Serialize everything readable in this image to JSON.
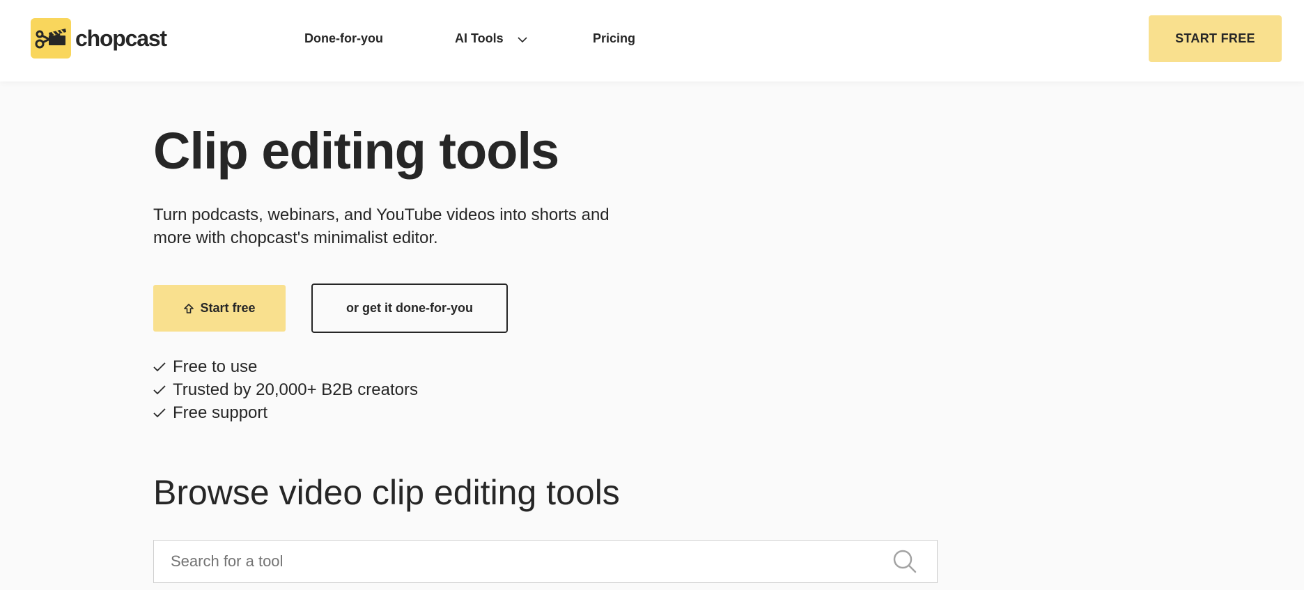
{
  "header": {
    "brand": "chopcast",
    "nav": [
      {
        "label": "Done-for-you"
      },
      {
        "label": "AI Tools",
        "has_dropdown": true
      },
      {
        "label": "Pricing"
      }
    ],
    "cta_label": "START FREE"
  },
  "hero": {
    "title": "Clip editing tools",
    "subtitle": "Turn podcasts, webinars, and YouTube videos into shorts and more with chopcast's minimalist editor.",
    "primary_button": "Start free",
    "secondary_button": "or get it done-for-you",
    "features": [
      "Free to use",
      "Trusted by 20,000+ B2B creators",
      "Free support"
    ]
  },
  "browse": {
    "title": "Browse video clip editing tools",
    "search_placeholder": "Search for a tool"
  },
  "colors": {
    "accent": "#f9e08e",
    "logo_bg": "#f9d65c",
    "text": "#262626",
    "background": "#fafafa"
  },
  "icons": {
    "logo": "scissors-clapper-icon",
    "dropdown": "chevron-down-icon",
    "start": "arrow-up-outline-icon",
    "feature": "check-icon",
    "search": "search-icon"
  }
}
